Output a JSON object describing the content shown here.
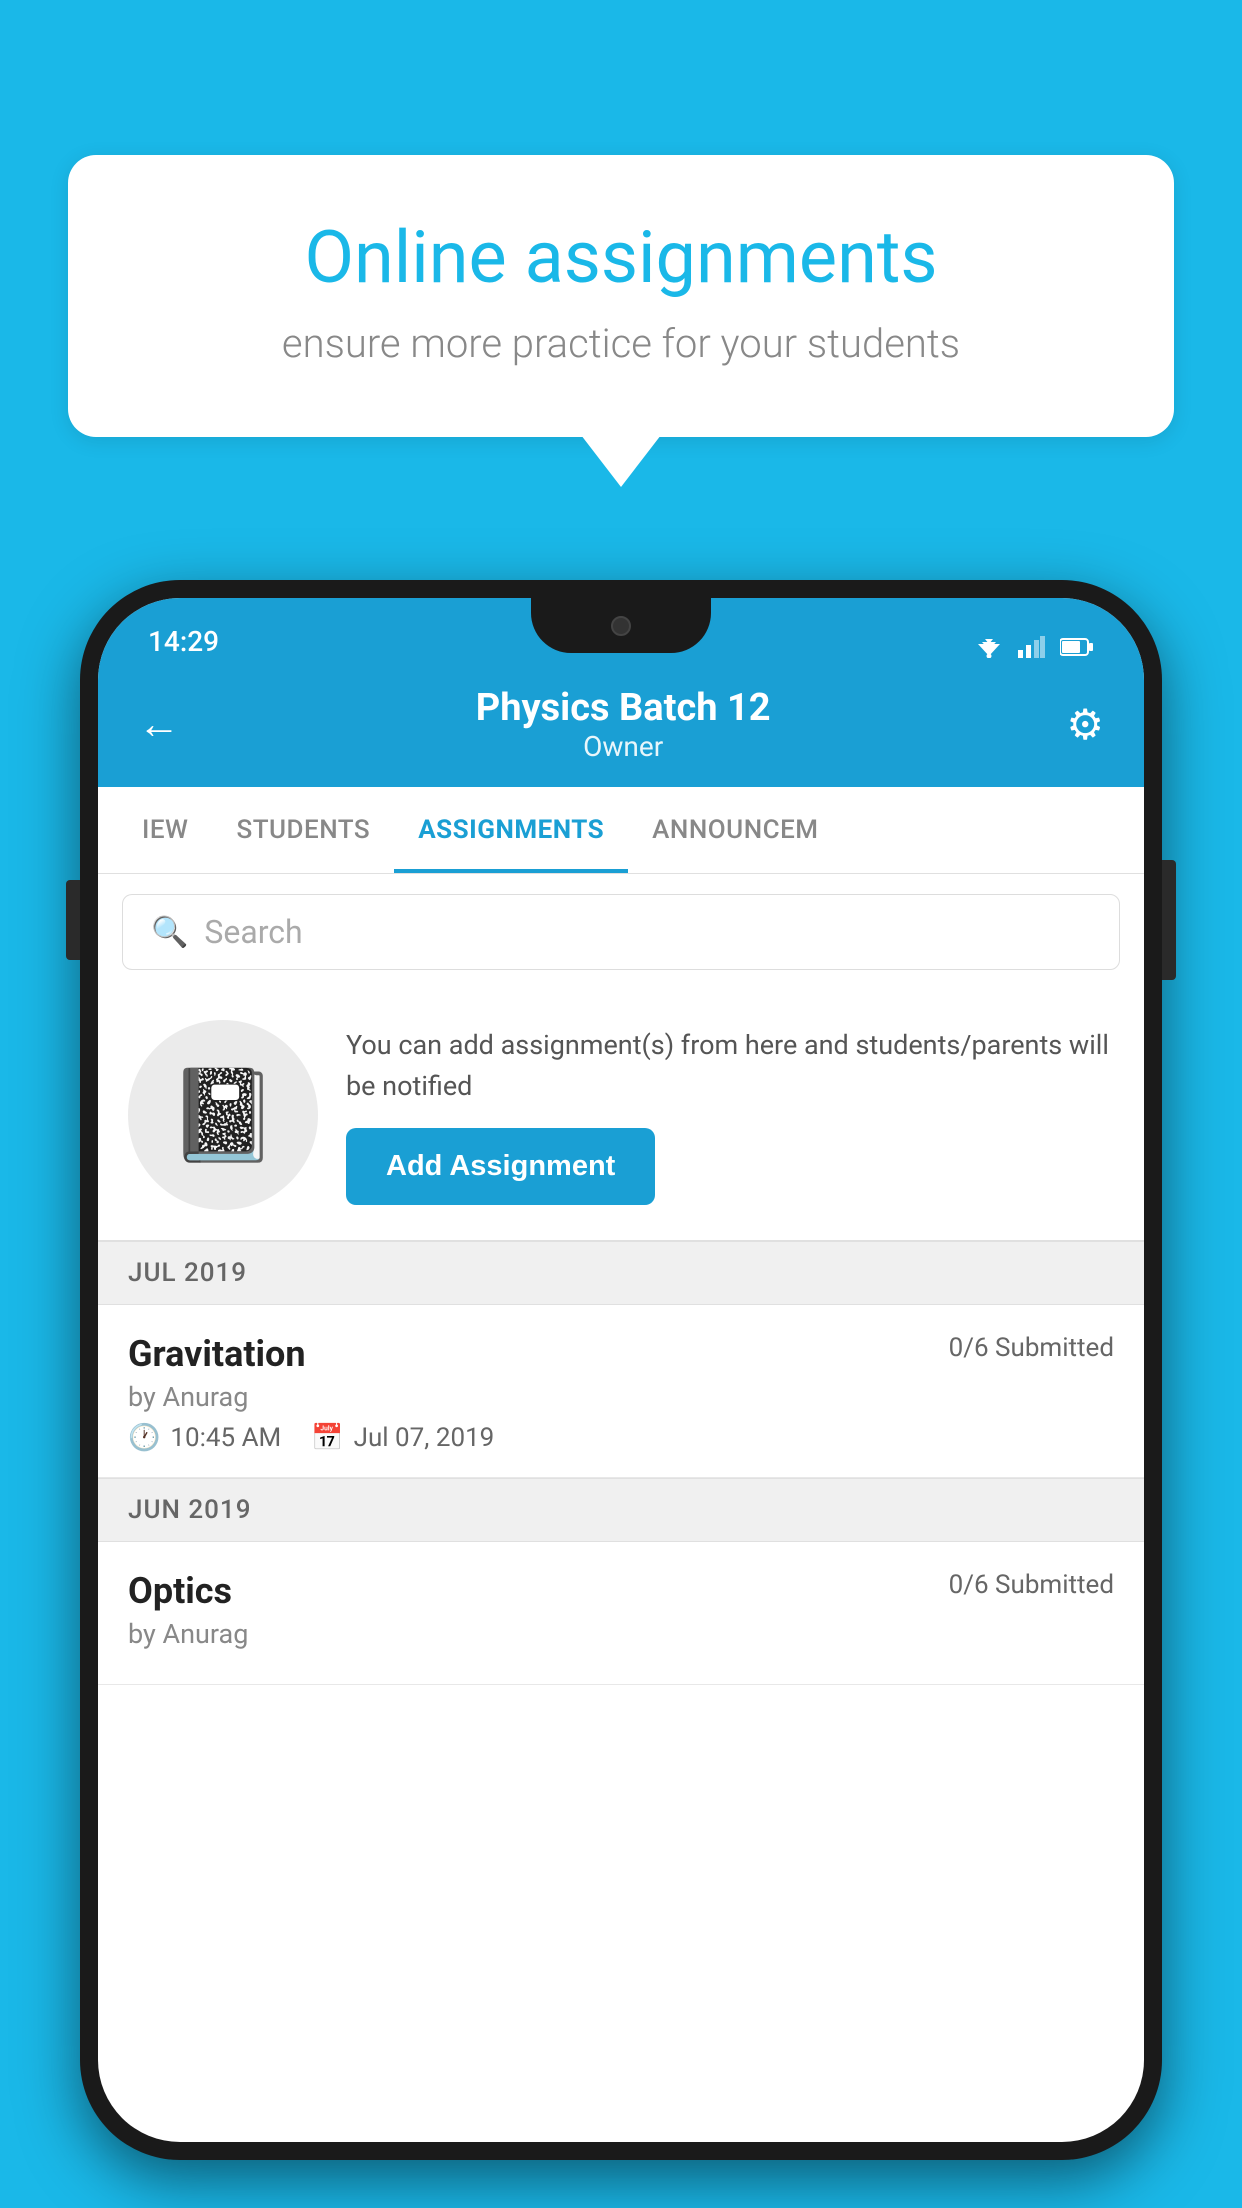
{
  "background_color": "#1ab8e8",
  "speech_bubble": {
    "title": "Online assignments",
    "subtitle": "ensure more practice for your students"
  },
  "status_bar": {
    "time": "14:29"
  },
  "header": {
    "title": "Physics Batch 12",
    "subtitle": "Owner"
  },
  "tabs": [
    {
      "id": "overview",
      "label": "IEW",
      "active": false
    },
    {
      "id": "students",
      "label": "STUDENTS",
      "active": false
    },
    {
      "id": "assignments",
      "label": "ASSIGNMENTS",
      "active": true
    },
    {
      "id": "announcements",
      "label": "ANNOUNCEM",
      "active": false
    }
  ],
  "search": {
    "placeholder": "Search"
  },
  "promo": {
    "description": "You can add assignment(s) from here and students/parents will be notified",
    "button_label": "Add Assignment"
  },
  "sections": [
    {
      "month_label": "JUL 2019",
      "assignments": [
        {
          "title": "Gravitation",
          "submitted": "0/6 Submitted",
          "author": "by Anurag",
          "time": "10:45 AM",
          "date": "Jul 07, 2019"
        }
      ]
    },
    {
      "month_label": "JUN 2019",
      "assignments": [
        {
          "title": "Optics",
          "submitted": "0/6 Submitted",
          "author": "by Anurag",
          "time": "",
          "date": ""
        }
      ]
    }
  ]
}
